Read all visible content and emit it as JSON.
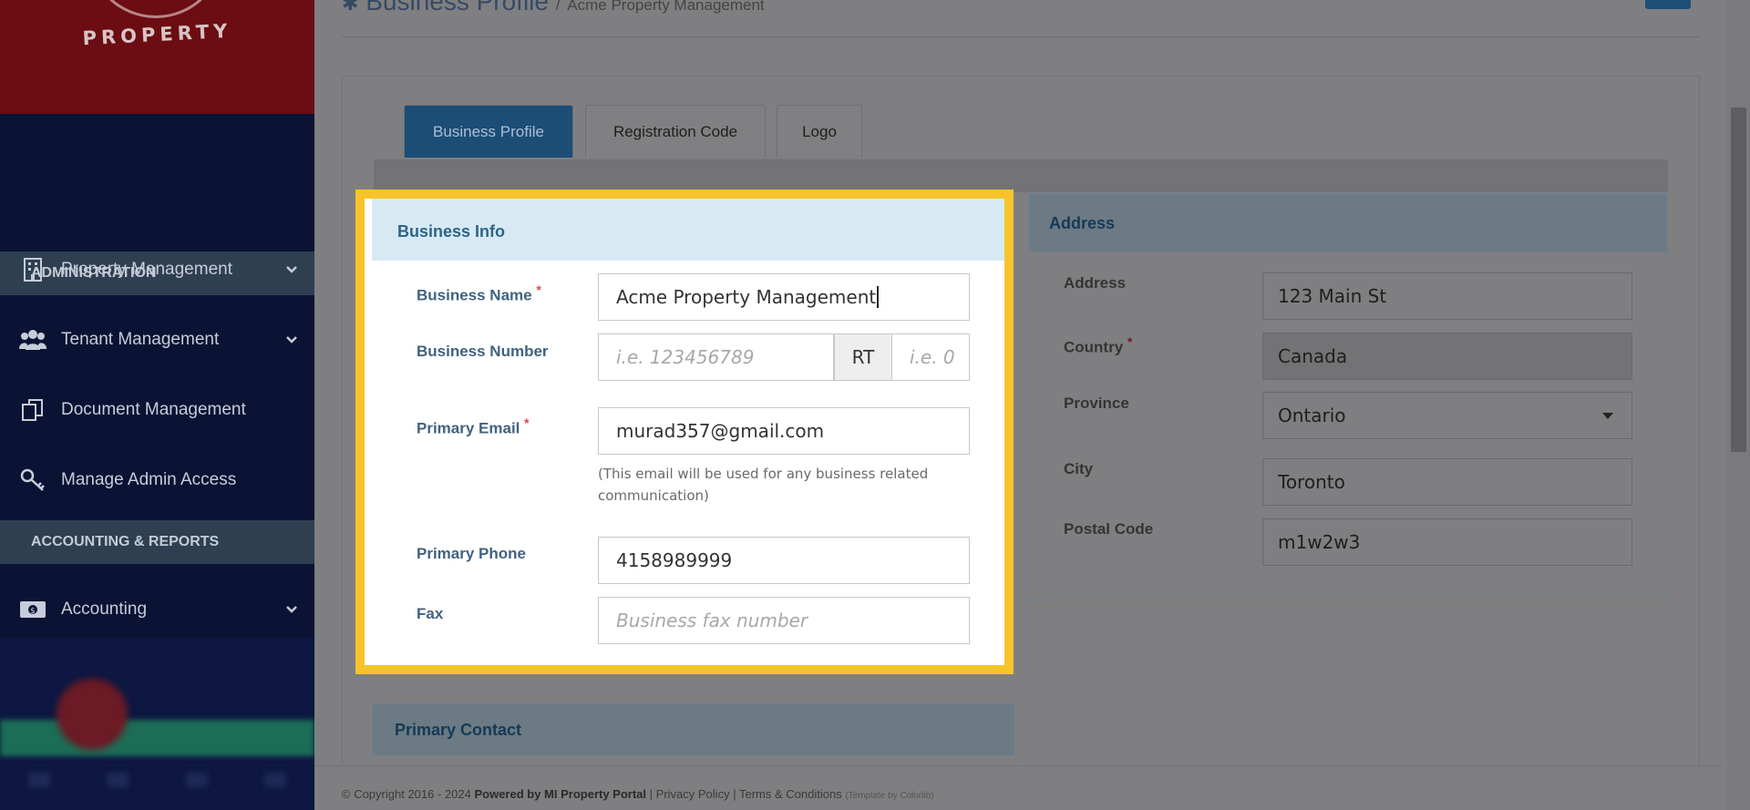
{
  "sidebar": {
    "logo_text": "PROPERTY",
    "sections": [
      {
        "label": "ADMINISTRATION"
      },
      {
        "label": "ACCOUNTING & REPORTS"
      }
    ],
    "items": [
      {
        "label": "Property Management",
        "icon": "building-icon",
        "has_chevron": true
      },
      {
        "label": "Tenant Management",
        "icon": "users-icon",
        "has_chevron": true
      },
      {
        "label": "Document Management",
        "icon": "documents-icon",
        "has_chevron": false
      },
      {
        "label": "Manage Admin Access",
        "icon": "key-icon",
        "has_chevron": false
      },
      {
        "label": "Accounting",
        "icon": "money-icon",
        "has_chevron": true
      }
    ]
  },
  "header": {
    "title": "Business Profile",
    "separator": "/",
    "subtitle": "Acme Property Management"
  },
  "tabs": [
    {
      "label": "Business Profile",
      "active": true
    },
    {
      "label": "Registration Code",
      "active": false
    },
    {
      "label": "Logo",
      "active": false
    }
  ],
  "business_info": {
    "heading": "Business Info",
    "business_name": {
      "label": "Business Name",
      "required_mark": "*",
      "value": "Acme Property Management"
    },
    "business_number": {
      "label": "Business Number",
      "placeholder": "i.e. 123456789",
      "addon": "RT",
      "suffix_placeholder": "i.e. 0"
    },
    "primary_email": {
      "label": "Primary Email",
      "required_mark": "*",
      "value": "murad357@gmail.com",
      "help": "(This email will be used for any business related communication)"
    },
    "primary_phone": {
      "label": "Primary Phone",
      "value": "4158989999"
    },
    "fax": {
      "label": "Fax",
      "placeholder": "Business fax number"
    }
  },
  "address": {
    "heading": "Address",
    "address": {
      "label": "Address",
      "value": "123 Main St"
    },
    "country": {
      "label": "Country",
      "required_mark": "*",
      "value": "Canada"
    },
    "province": {
      "label": "Province",
      "value": "Ontario"
    },
    "city": {
      "label": "City",
      "value": "Toronto"
    },
    "postal_code": {
      "label": "Postal Code",
      "value": "m1w2w3"
    }
  },
  "primary_contact": {
    "heading": "Primary Contact"
  },
  "footer": {
    "copyright": "© Copyright 2016 - 2024",
    "powered": "Powered by MI Property Portal",
    "sep1": "|",
    "privacy": "Privacy Policy",
    "sep2": "|",
    "terms": "Terms & Conditions",
    "template": "(Template by Colorlib)"
  },
  "colors": {
    "sidebar_bg": "#0a1333",
    "highlight_border": "#f6c42a",
    "active_tab": "#1b4d77",
    "card_header": "#d7eaf4"
  }
}
